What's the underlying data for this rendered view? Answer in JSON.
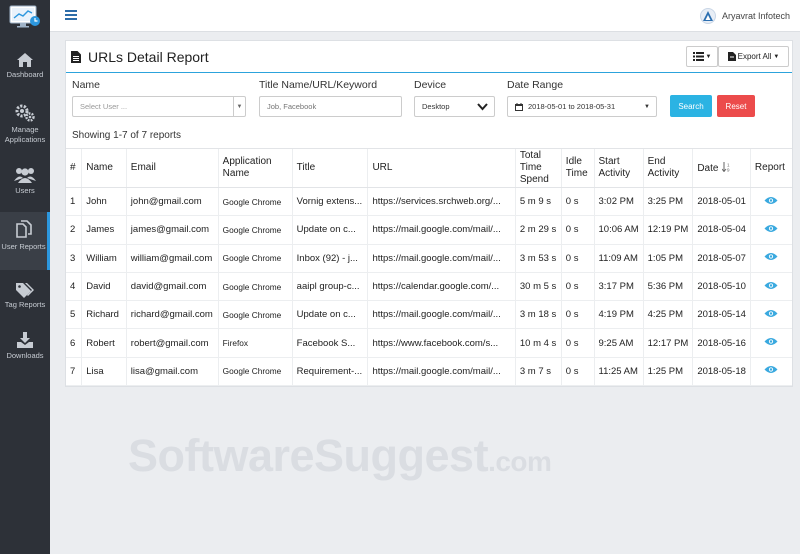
{
  "app": {
    "company": "Aryavrat Infotech"
  },
  "sidebar": {
    "items": [
      {
        "label": "Dashboard",
        "icon": "home-icon"
      },
      {
        "label": "Manage Applications",
        "icon": "gears-icon"
      },
      {
        "label": "Users",
        "icon": "users-icon"
      },
      {
        "label": "User Reports",
        "icon": "copy-icon"
      },
      {
        "label": "Tag Reports",
        "icon": "tags-icon"
      },
      {
        "label": "Downloads",
        "icon": "download-icon"
      }
    ]
  },
  "report": {
    "title": "URLs Detail Report",
    "export_label": "Export All",
    "showing": "Showing 1-7 of 7 reports"
  },
  "filters": {
    "name": {
      "label": "Name",
      "placeholder": "Select User ..."
    },
    "title": {
      "label": "Title Name/URL/Keyword",
      "placeholder": "Job, Facebook"
    },
    "device": {
      "label": "Device",
      "value": "Desktop"
    },
    "date": {
      "label": "Date Range",
      "value": "2018-05-01 to 2018-05-31"
    },
    "search_label": "Search",
    "reset_label": "Reset"
  },
  "table": {
    "headers": {
      "num": "#",
      "name": "Name",
      "email": "Email",
      "app": "Application Name",
      "title": "Title",
      "url": "URL",
      "total": "Total Time Spend",
      "idle": "Idle Time",
      "start": "Start Activity",
      "end": "End Activity",
      "date": "Date",
      "report": "Report"
    },
    "rows": [
      {
        "num": "1",
        "name": "John",
        "email": "john@gmail.com",
        "app": "Google Chrome",
        "title": "Vornig extens...",
        "url": "https://services.srchweb.org/...",
        "total": "5 m 9 s",
        "idle": "0 s",
        "start": "3:02 PM",
        "end": "3:25 PM",
        "date": "2018-05-01"
      },
      {
        "num": "2",
        "name": "James",
        "email": "james@gmail.com",
        "app": "Google Chrome",
        "title": "Update on c...",
        "url": "https://mail.google.com/mail/...",
        "total": "2 m 29 s",
        "idle": "0 s",
        "start": "10:06 AM",
        "end": "12:19 PM",
        "date": "2018-05-04"
      },
      {
        "num": "3",
        "name": "William",
        "email": "william@gmail.com",
        "app": "Google Chrome",
        "title": "Inbox (92) - j...",
        "url": "https://mail.google.com/mail/...",
        "total": "3 m 53 s",
        "idle": "0 s",
        "start": "11:09 AM",
        "end": "1:05 PM",
        "date": "2018-05-07"
      },
      {
        "num": "4",
        "name": "David",
        "email": "david@gmail.com",
        "app": "Google Chrome",
        "title": "aaipl group-c...",
        "url": "https://calendar.google.com/...",
        "total": "30 m 5 s",
        "idle": "0 s",
        "start": "3:17 PM",
        "end": "5:36 PM",
        "date": "2018-05-10"
      },
      {
        "num": "5",
        "name": "Richard",
        "email": "richard@gmail.com",
        "app": "Google Chrome",
        "title": "Update on c...",
        "url": "https://mail.google.com/mail/...",
        "total": "3 m 18 s",
        "idle": "0 s",
        "start": "4:19 PM",
        "end": "4:25 PM",
        "date": "2018-05-14"
      },
      {
        "num": "6",
        "name": "Robert",
        "email": "robert@gmail.com",
        "app": "Firefox",
        "title": "Facebook S...",
        "url": "https://www.facebook.com/s...",
        "total": "10 m 4 s",
        "idle": "0 s",
        "start": "9:25 AM",
        "end": "12:17 PM",
        "date": "2018-05-16"
      },
      {
        "num": "7",
        "name": "Lisa",
        "email": "lisa@gmail.com",
        "app": "Google Chrome",
        "title": "Requirement-...",
        "url": "https://mail.google.com/mail/...",
        "total": "3 m 7 s",
        "idle": "0 s",
        "start": "11:25 AM",
        "end": "1:25 PM",
        "date": "2018-05-18"
      }
    ]
  },
  "watermark": {
    "main": "SoftwareSuggest",
    "domain": ".com"
  },
  "colors": {
    "sidebar": "#2d3138",
    "accent": "#2ca3dc",
    "search": "#2bb3e3",
    "reset": "#ec4b4b",
    "eye": "#3aa9df"
  }
}
